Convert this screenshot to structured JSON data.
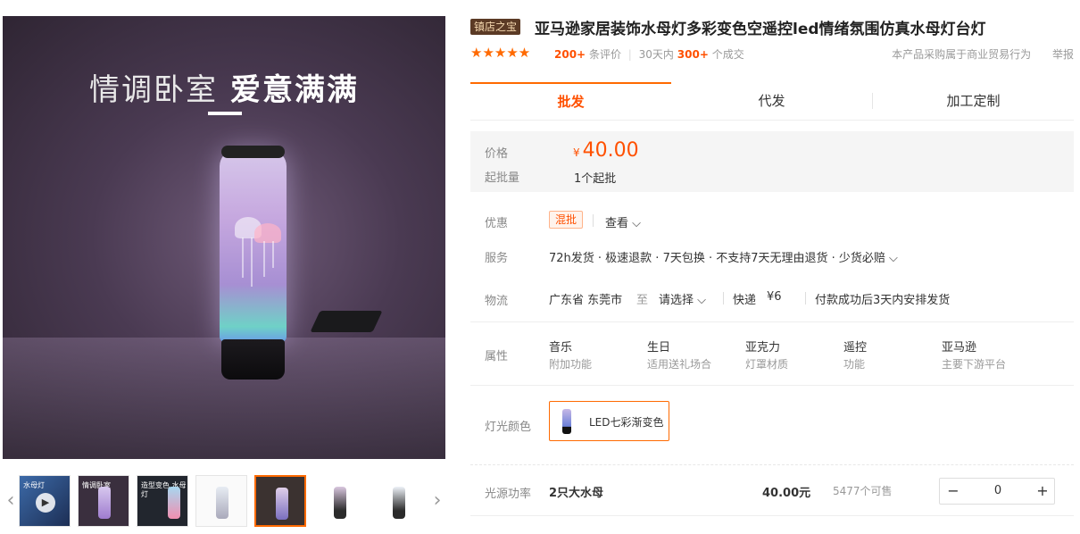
{
  "gallery": {
    "hero_title_light": "情调卧室",
    "hero_title_bold": "爱意满满",
    "thumbs": [
      {
        "kind": "video",
        "text": "水母灯"
      },
      {
        "kind": "image",
        "text": "情调卧室"
      },
      {
        "kind": "image",
        "text": "造型变色 水母灯"
      },
      {
        "kind": "image",
        "text": ""
      },
      {
        "kind": "image",
        "text": ""
      },
      {
        "kind": "image",
        "text": ""
      },
      {
        "kind": "image",
        "text": ""
      }
    ]
  },
  "product": {
    "badge": "镇店之宝",
    "title": "亚马逊家居装饰水母灯多彩变色空遥控led情绪氛围仿真水母灯台灯"
  },
  "meta": {
    "stars": "★★★★★",
    "review_count": "200+",
    "review_label": "条评价",
    "period": "30天内",
    "sold_count": "300+",
    "sold_label": "个成交",
    "trade_note": "本产品采购属于商业贸易行为",
    "report": "举报"
  },
  "tabs": [
    "批发",
    "代发",
    "加工定制"
  ],
  "price": {
    "label": "价格",
    "currency": "¥",
    "value": "40.00",
    "moq_label": "起批量",
    "moq_value": "1个起批"
  },
  "discount": {
    "label": "优惠",
    "tag": "混批",
    "view": "查看 ⌵"
  },
  "service": {
    "label": "服务",
    "items": "72h发货 · 极速退款 · 7天包换 · 不支持7天无理由退货 · 少货必赔 ⌵"
  },
  "logistics": {
    "label": "物流",
    "origin": "广东省 东莞市",
    "to": "至",
    "destination": "请选择 ⌵",
    "express": "快递",
    "fee": "¥6",
    "ship_note": "付款成功后3天内安排发货"
  },
  "attributes": {
    "label": "属性",
    "items": [
      {
        "value": "音乐",
        "key": "附加功能"
      },
      {
        "value": "生日",
        "key": "适用送礼场合"
      },
      {
        "value": "亚克力",
        "key": "灯罩材质"
      },
      {
        "value": "遥控",
        "key": "功能"
      },
      {
        "value": "亚马逊",
        "key": "主要下游平台"
      }
    ]
  },
  "color": {
    "label": "灯光颜色",
    "option": "LED七彩渐变色"
  },
  "spec": {
    "label": "光源功率",
    "name": "2只大水母",
    "price": "40.00元",
    "stock": "5477个可售",
    "qty": "0",
    "minus": "−",
    "plus": "+"
  }
}
